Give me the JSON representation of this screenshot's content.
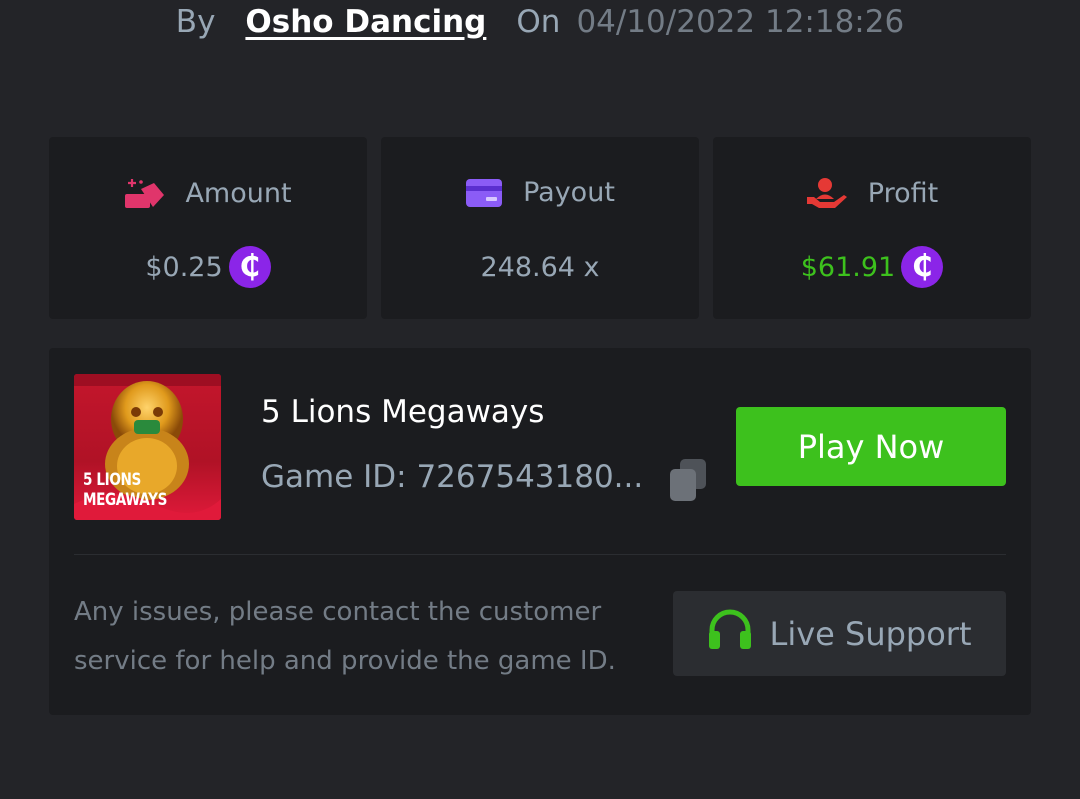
{
  "header": {
    "by_label": "By",
    "username": "Osho Dancing",
    "on_label": "On",
    "datetime": "04/10/2022 12:18:26"
  },
  "stats": {
    "amount": {
      "label": "Amount",
      "value": "$0.25",
      "icon": "amount-icon",
      "icon_color": "#e0356b",
      "currency_icon": "coin-icon"
    },
    "payout": {
      "label": "Payout",
      "value": "248.64 x",
      "icon": "card-icon",
      "icon_color": "#8b5cf6"
    },
    "profit": {
      "label": "Profit",
      "value": "$61.91",
      "icon": "profit-icon",
      "icon_color": "#e53935",
      "value_color": "#3dc11d",
      "currency_icon": "coin-icon"
    },
    "coin_symbol": "₵",
    "coin_color": "#8b25e8"
  },
  "game": {
    "name": "5 Lions Megaways",
    "id_text": "Game ID: 7267543180...",
    "thumbnail_text_line1": "5 LIONS",
    "thumbnail_text_line2": "MEGAWAYS",
    "play_label": "Play Now"
  },
  "support": {
    "help_text": "Any issues, please contact the customer service for help and provide the game ID.",
    "button_label": "Live Support"
  },
  "colors": {
    "background": "#232428",
    "card": "#1b1c1f",
    "accent_green": "#3dc11d"
  }
}
